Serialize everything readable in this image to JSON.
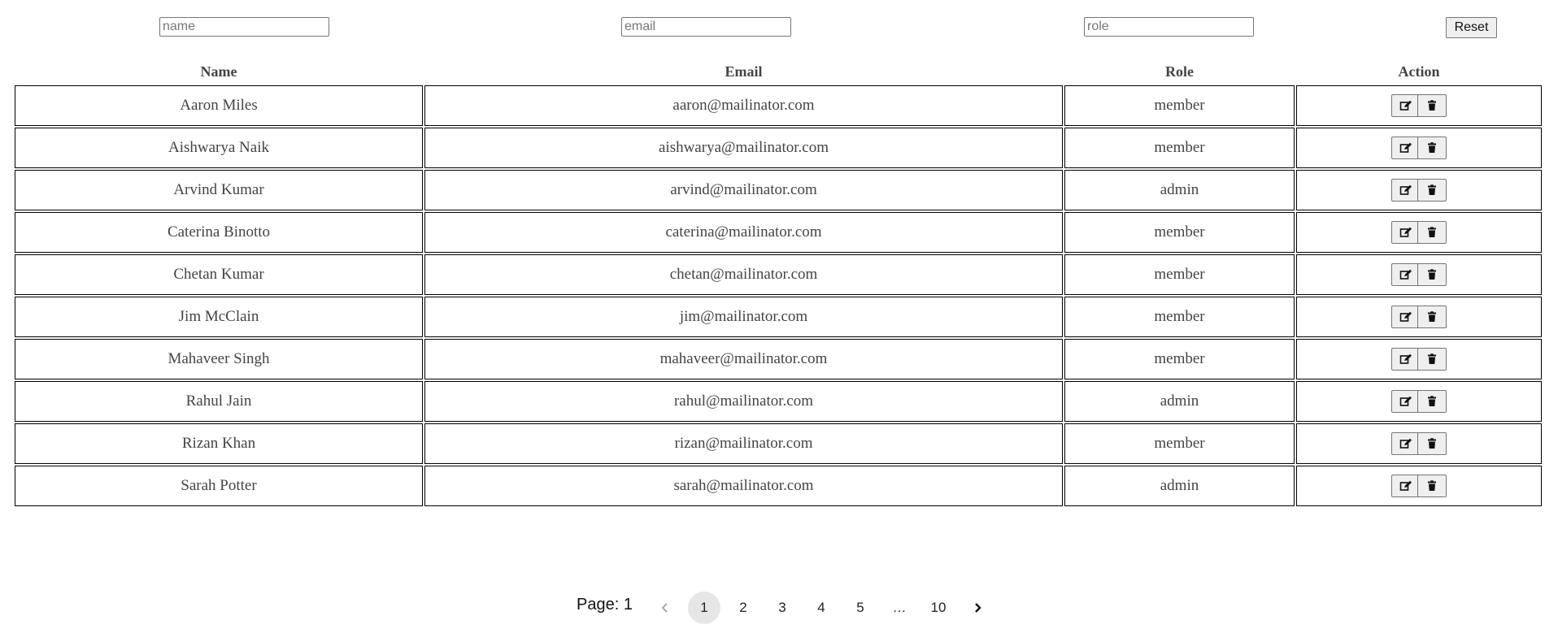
{
  "filters": {
    "name_placeholder": "name",
    "email_placeholder": "email",
    "role_placeholder": "role",
    "name_value": "",
    "email_value": "",
    "role_value": "",
    "reset_label": "Reset"
  },
  "table": {
    "headers": [
      "Name",
      "Email",
      "Role",
      "Action"
    ],
    "rows": [
      {
        "name": "Aaron Miles",
        "email": "aaron@mailinator.com",
        "role": "member"
      },
      {
        "name": "Aishwarya Naik",
        "email": "aishwarya@mailinator.com",
        "role": "member"
      },
      {
        "name": "Arvind Kumar",
        "email": "arvind@mailinator.com",
        "role": "admin"
      },
      {
        "name": "Caterina Binotto",
        "email": "caterina@mailinator.com",
        "role": "member"
      },
      {
        "name": "Chetan Kumar",
        "email": "chetan@mailinator.com",
        "role": "member"
      },
      {
        "name": "Jim McClain",
        "email": "jim@mailinator.com",
        "role": "member"
      },
      {
        "name": "Mahaveer Singh",
        "email": "mahaveer@mailinator.com",
        "role": "member"
      },
      {
        "name": "Rahul Jain",
        "email": "rahul@mailinator.com",
        "role": "admin"
      },
      {
        "name": "Rizan Khan",
        "email": "rizan@mailinator.com",
        "role": "member"
      },
      {
        "name": "Sarah Potter",
        "email": "sarah@mailinator.com",
        "role": "admin"
      }
    ],
    "row_actions": [
      "edit-icon",
      "trash-icon"
    ]
  },
  "pagination": {
    "label": "Page: 1",
    "pages": [
      "1",
      "2",
      "3",
      "4",
      "5",
      "…",
      "10"
    ],
    "active_page": "1",
    "prev_icon": "chevron-left-icon",
    "next_icon": "chevron-right-icon"
  }
}
